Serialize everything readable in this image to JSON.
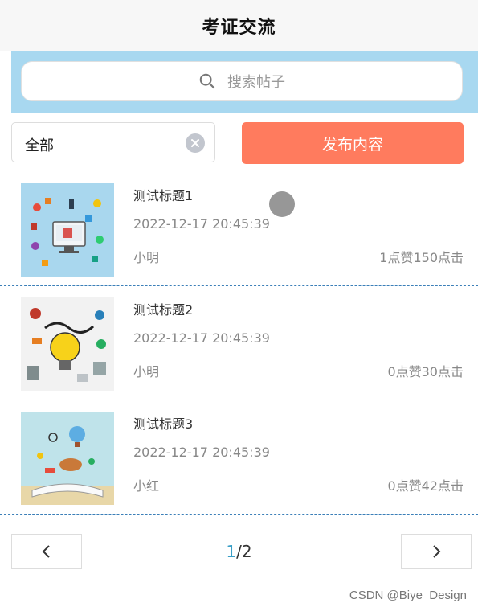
{
  "header": {
    "title": "考证交流"
  },
  "search": {
    "placeholder": "搜索帖子",
    "icon": "search-icon"
  },
  "filter": {
    "selected": "全部",
    "publish_label": "发布内容"
  },
  "posts": [
    {
      "title": "测试标题1",
      "date": "2022-12-17 20:45:39",
      "author": "小明",
      "likes": "1点赞",
      "clicks": "150点击"
    },
    {
      "title": "测试标题2",
      "date": "2022-12-17 20:45:39",
      "author": "小明",
      "likes": "0点赞",
      "clicks": "30点击"
    },
    {
      "title": "测试标题3",
      "date": "2022-12-17 20:45:39",
      "author": "小红",
      "likes": "0点赞",
      "clicks": "42点击"
    }
  ],
  "pagination": {
    "current": "1",
    "separator": "/",
    "total": "2"
  },
  "watermark": "CSDN @Biye_Design",
  "colors": {
    "accent": "#ff7b5e",
    "search_band": "#a8d8f0",
    "divider": "#3b7fb8",
    "page_current": "#3a9fc7"
  }
}
